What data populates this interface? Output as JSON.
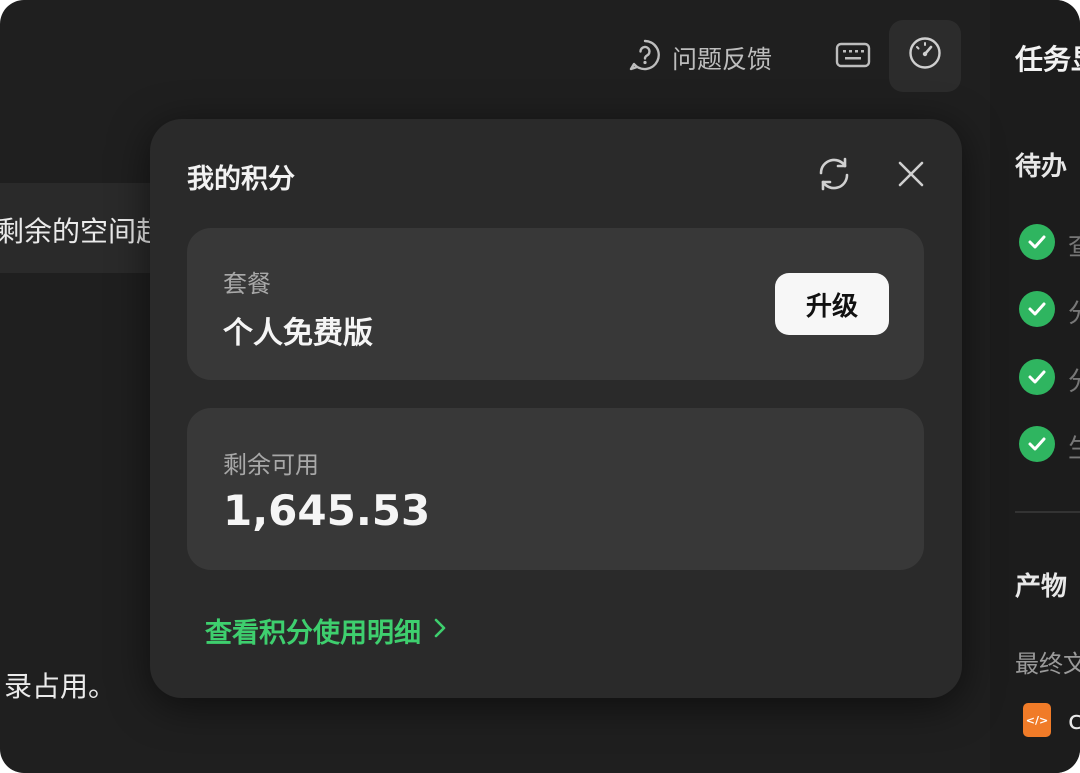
{
  "topbar": {
    "feedback_label": "问题反馈"
  },
  "background": {
    "chip_text": "剩余的空间超",
    "bottom_text": "录占用。"
  },
  "right_panel": {
    "title": "任务显",
    "todo_label": "待办",
    "todo_items": [
      "查",
      "分",
      "分",
      "生"
    ],
    "products_label": "产物",
    "final_label": "最终文",
    "file_text": "c",
    "check_color": "#2fb560",
    "file_icon_color": "#f07b28"
  },
  "popup": {
    "title": "我的积分",
    "plan": {
      "label": "套餐",
      "value": "个人免费版",
      "upgrade_label": "升级"
    },
    "balance": {
      "label": "剩余可用",
      "value": "1,645.53"
    },
    "detail_link": "查看积分使用明细",
    "accent_color": "#3ecf6e"
  },
  "icons": [
    "question-circle-icon",
    "keyboard-icon",
    "gauge-icon",
    "refresh-icon",
    "close-icon",
    "chevron-right-icon",
    "check-icon",
    "code-file-icon"
  ]
}
